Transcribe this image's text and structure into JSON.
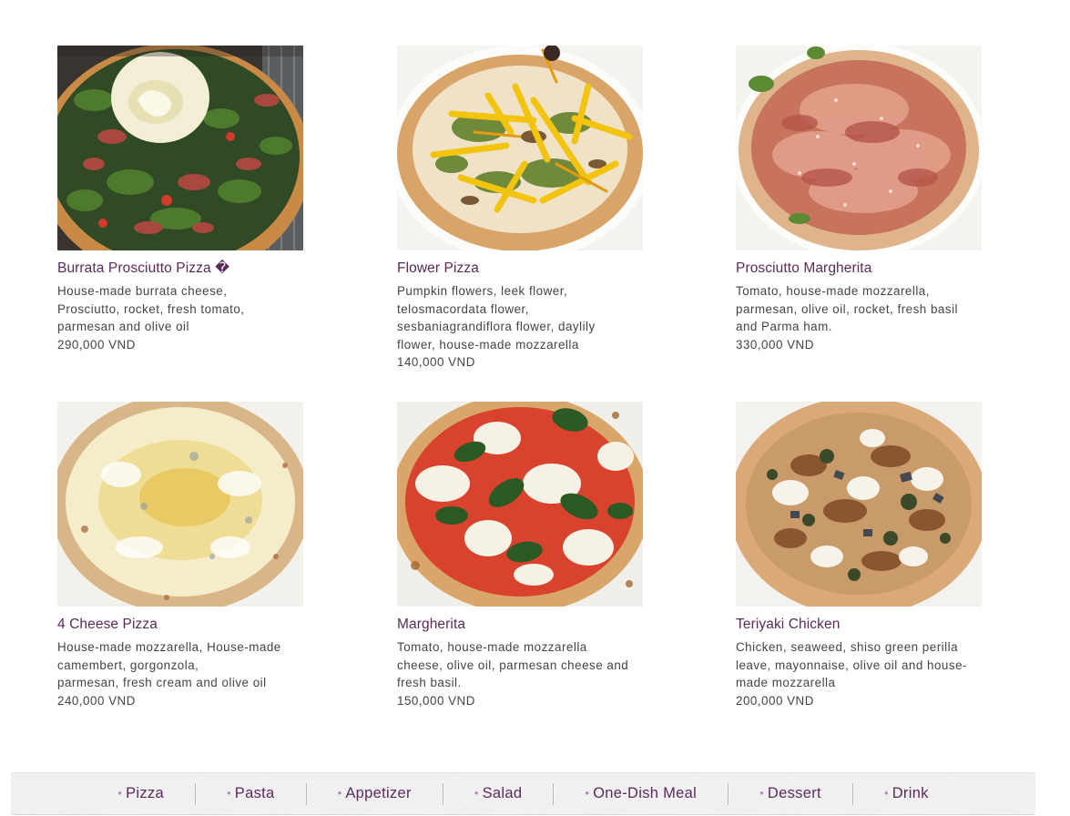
{
  "colors": {
    "item_name": "#5b2a5b",
    "body_text": "#444444",
    "nav_text": "#5b2a5b",
    "nav_bg": "#ededed",
    "nav_bullet": "#b48ab4"
  },
  "menu": {
    "items": [
      {
        "name": "Burrata Prosciutto Pizza �",
        "description": "House-made burrata cheese,\nProsciutto, rocket, fresh tomato,\nparmesan and olive oil",
        "price": "290,000 VND",
        "photo_icon": "burrata-pizza-photo"
      },
      {
        "name": "Flower Pizza",
        "description": "Pumpkin flowers, leek flower,\ntelosmacordata flower,\nsesbaniagrandiflora flower, daylily\nflower, house-made mozzarella",
        "price": "140,000 VND",
        "photo_icon": "flower-pizza-photo"
      },
      {
        "name": "Prosciutto Margherita",
        "description": "Tomato, house-made mozzarella,\nparmesan, olive oil, rocket, fresh basil\nand Parma ham.",
        "price": "330,000 VND",
        "photo_icon": "prosciutto-pizza-photo"
      },
      {
        "name": "4 Cheese Pizza",
        "description": "House-made mozzarella,  House-made\ncamembert, gorgonzola,\nparmesan,  fresh cream and olive oil",
        "price": "240,000 VND",
        "photo_icon": "four-cheese-pizza-photo"
      },
      {
        "name": "Margherita",
        "description": "Tomato, house-made mozzarella\ncheese,  olive oil, parmesan cheese and\nfresh basil.",
        "price": "150,000 VND",
        "photo_icon": "margherita-pizza-photo"
      },
      {
        "name": "Teriyaki Chicken",
        "description": "Chicken, seaweed, shiso green perilla\nleave, mayonnaise, olive oil and house-\nmade mozzarella",
        "price": "200,000 VND",
        "photo_icon": "teriyaki-pizza-photo"
      }
    ]
  },
  "nav": {
    "items": [
      {
        "label": "Pizza"
      },
      {
        "label": "Pasta"
      },
      {
        "label": "Appetizer"
      },
      {
        "label": "Salad"
      },
      {
        "label": "One-Dish Meal"
      },
      {
        "label": "Dessert"
      },
      {
        "label": "Drink"
      }
    ]
  }
}
